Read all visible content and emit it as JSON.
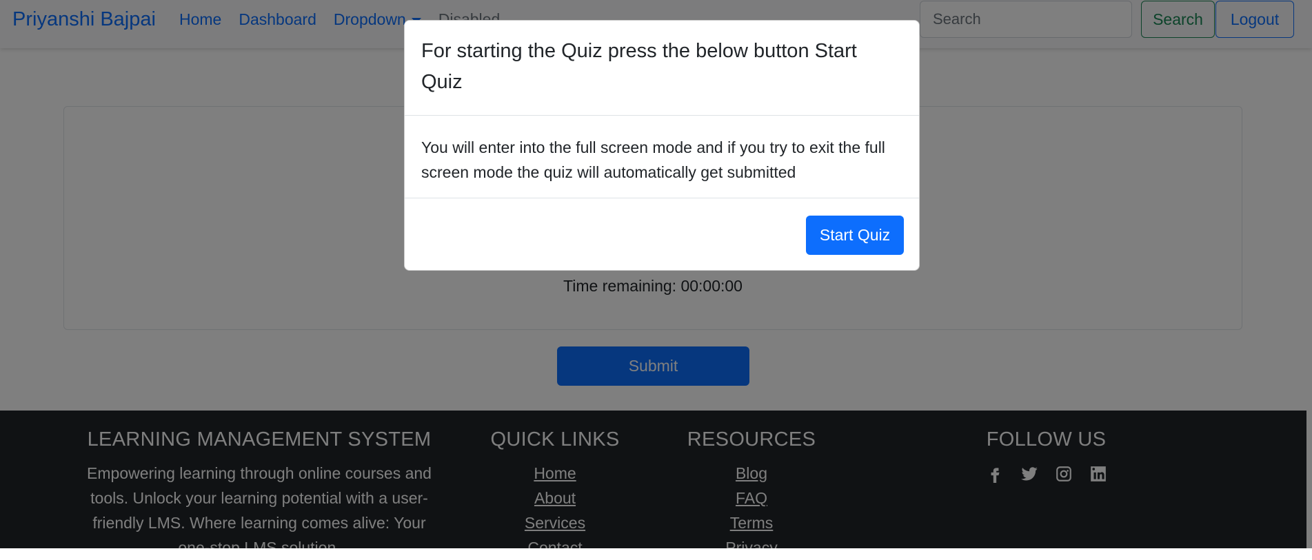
{
  "navbar": {
    "brand": "Priyanshi Bajpai",
    "links": [
      "Home",
      "Dashboard",
      "Dropdown",
      "Disabled"
    ],
    "search_placeholder": "Search",
    "search_button": "Search",
    "logout_button": "Logout"
  },
  "main": {
    "timer": "Time remaining: 00:00:00",
    "submit_button": "Submit"
  },
  "modal": {
    "title": "For starting the Quiz press the below button Start Quiz",
    "body": "You will enter into the full screen mode and if you try to exit the full screen mode the quiz will automatically get submitted",
    "start_button": "Start Quiz"
  },
  "footer": {
    "lms_heading": "LEARNING MANAGEMENT SYSTEM",
    "lms_text": "Empowering learning through online courses and tools. Unlock your learning potential with a user-friendly LMS. Where learning comes alive: Your one-stop LMS solution.",
    "quick_heading": "QUICK LINKS",
    "quick_links": [
      "Home",
      "About",
      "Services",
      "Contact"
    ],
    "resources_heading": "RESOURCES",
    "resources": [
      "Blog",
      "FAQ",
      "Terms",
      "Privacy"
    ],
    "follow_heading": "FOLLOW US",
    "social_icons": [
      "facebook-icon",
      "twitter-icon",
      "instagram-icon",
      "linkedin-icon"
    ]
  }
}
